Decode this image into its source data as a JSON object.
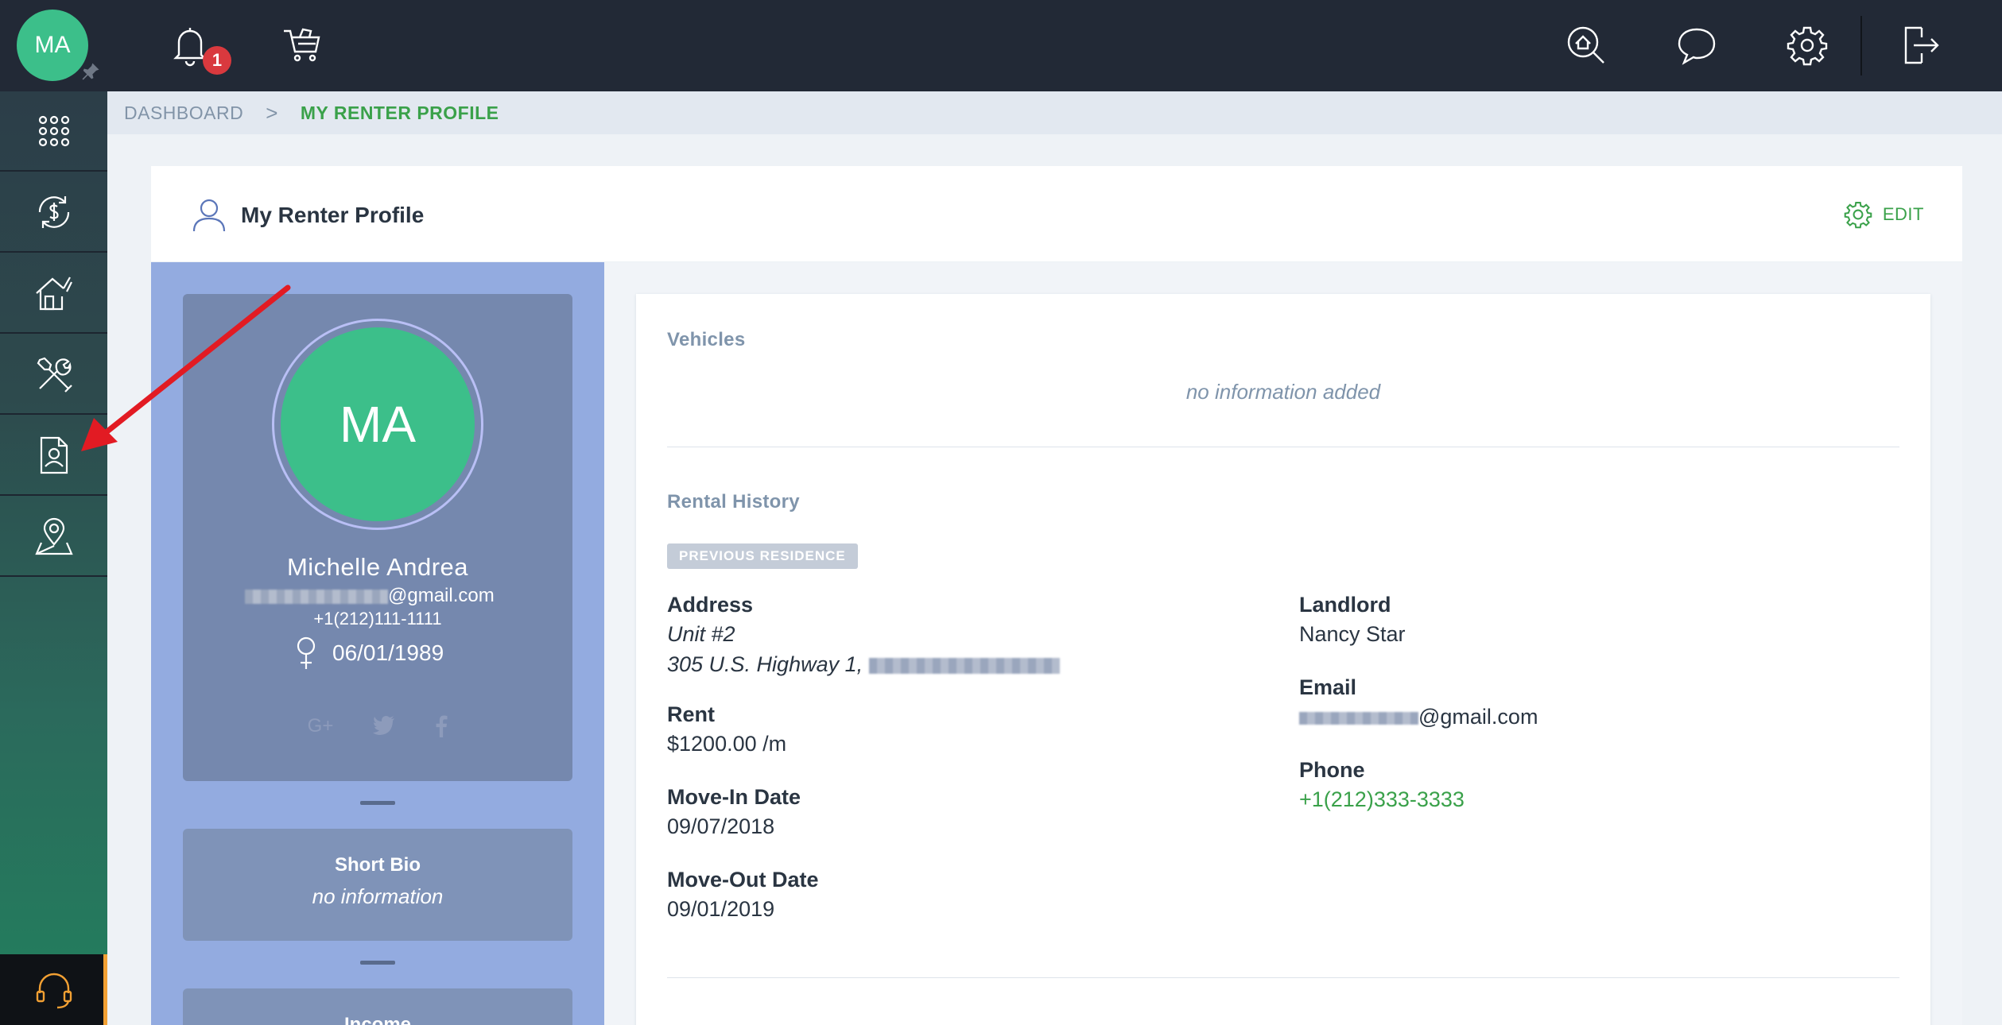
{
  "colors": {
    "accent_green": "#3aa14a",
    "avatar_green": "#3cbf8a",
    "topbar_bg": "#222936",
    "badge_red": "#d9393e",
    "annotation_red": "#e21b23"
  },
  "user": {
    "initials": "MA"
  },
  "sidebar": {
    "items": [
      {
        "icon": "grid-icon"
      },
      {
        "icon": "payments-icon"
      },
      {
        "icon": "home-repair-icon"
      },
      {
        "icon": "tools-icon"
      },
      {
        "icon": "renter-profile-icon"
      },
      {
        "icon": "map-pin-icon"
      }
    ],
    "support_icon": "headset-icon"
  },
  "topbar": {
    "notifications_count": "1",
    "icons": [
      "bell-icon",
      "cart-icon",
      "home-search-icon",
      "chat-icon",
      "gear-icon",
      "logout-icon"
    ]
  },
  "breadcrumb": {
    "items": [
      "DASHBOARD",
      "MY RENTER PROFILE"
    ],
    "separator": ">"
  },
  "card": {
    "title": "My Renter Profile",
    "edit_label": "EDIT"
  },
  "profile": {
    "initials": "MA",
    "name": "Michelle Andrea",
    "email_visible": "@gmail.com",
    "phone": "+1(212)111-1111",
    "dob": "06/01/1989",
    "gender_icon": "female-icon",
    "social": [
      "G+",
      "twitter-icon",
      "facebook-icon"
    ]
  },
  "bio": {
    "title": "Short Bio",
    "text": "no information"
  },
  "income": {
    "title": "Income"
  },
  "vehicles": {
    "title": "Vehicles",
    "empty_text": "no information added"
  },
  "rental_history": {
    "title": "Rental History",
    "badge": "PREVIOUS RESIDENCE",
    "address_label": "Address",
    "address_line1": "Unit #2",
    "address_line2": "305 U.S. Highway 1,",
    "rent_label": "Rent",
    "rent_value": "$1200.00 /m",
    "move_in_label": "Move-In Date",
    "move_in_value": "09/07/2018",
    "move_out_label": "Move-Out Date",
    "move_out_value": "09/01/2019",
    "landlord_label": "Landlord",
    "landlord_value": "Nancy Star",
    "email_label": "Email",
    "email_value_visible": "@gmail.com",
    "phone_label": "Phone",
    "phone_value": "+1(212)333-3333"
  }
}
